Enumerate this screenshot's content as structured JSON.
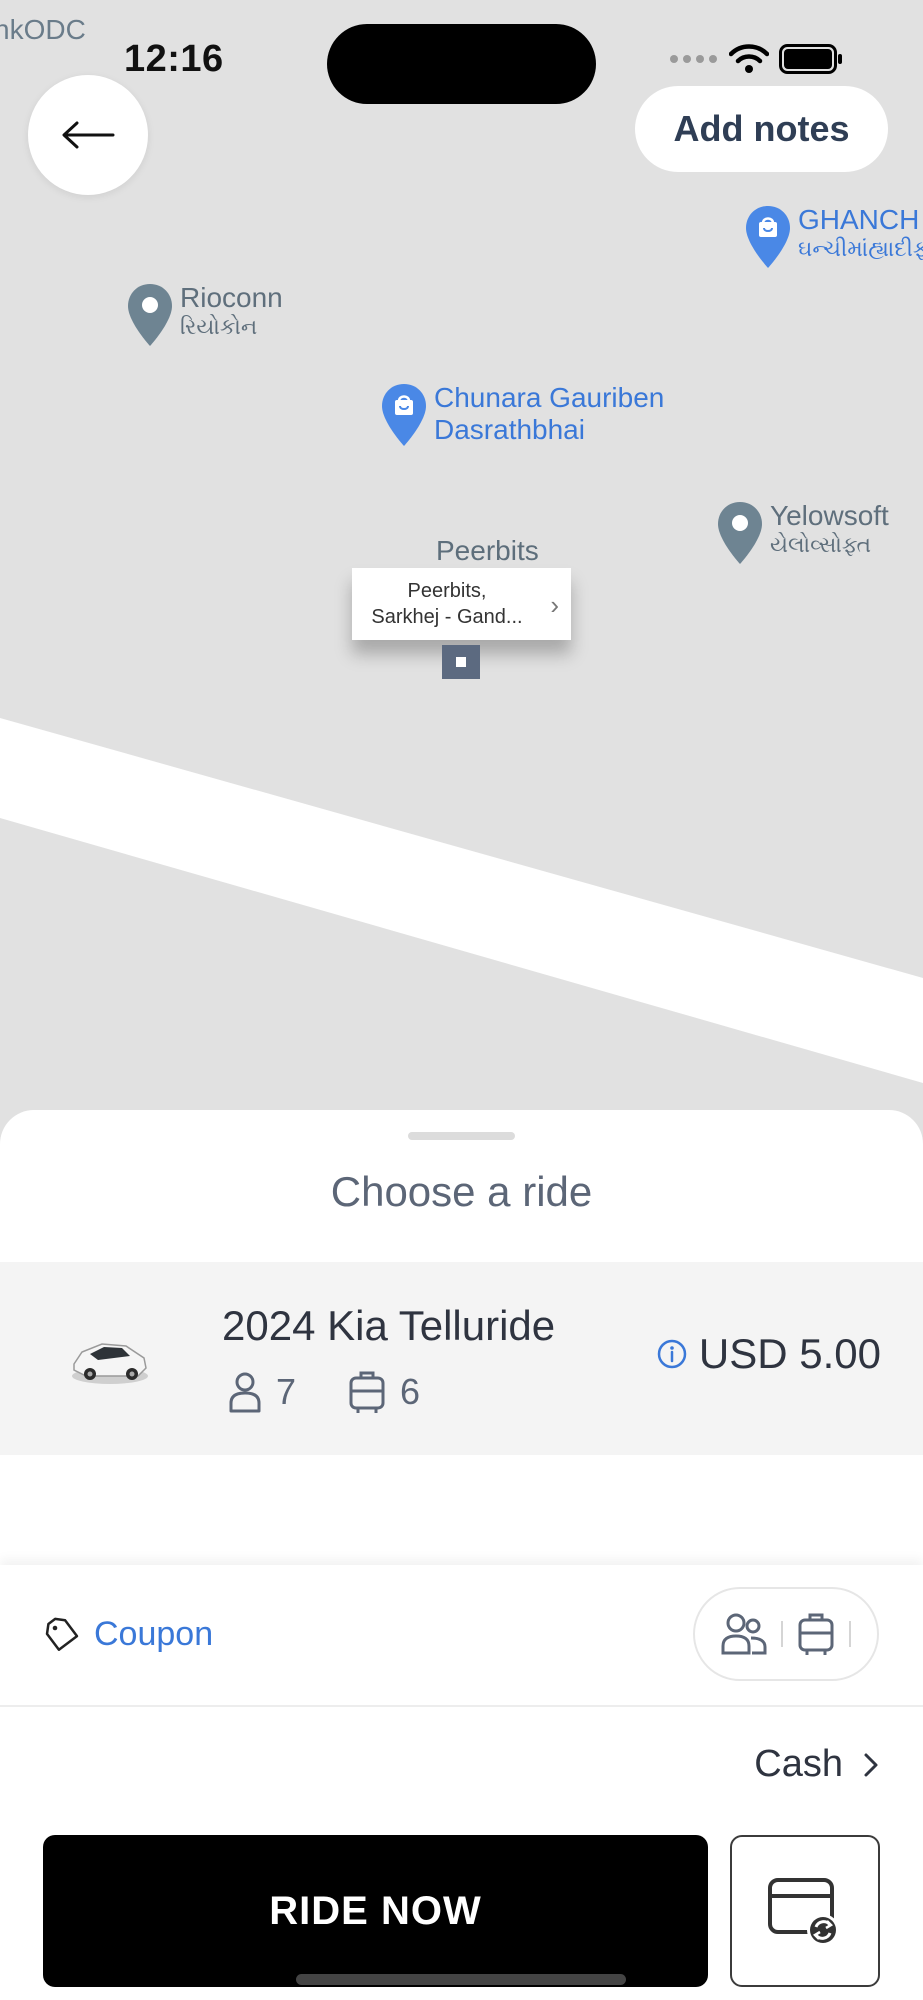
{
  "status_bar": {
    "time": "12:16"
  },
  "map": {
    "corner_label": "nkODC",
    "pois": [
      {
        "name": "Rioconn",
        "sub": "રિયોકોન",
        "style": "grey"
      },
      {
        "name": "Chunara Gauriben",
        "name2": "Dasrathbhai",
        "style": "blue"
      },
      {
        "name": "GHANCH",
        "sub": "ઘન્ચીમાંહ્યાદીફ",
        "style": "blue"
      },
      {
        "name": "Yelowsoft",
        "sub": "યેલોવ્સોફ્ત",
        "style": "grey"
      }
    ],
    "area_label": "Peerbits",
    "callout": {
      "line1": "Peerbits,",
      "line2": "Sarkhej - Gand..."
    }
  },
  "top_controls": {
    "add_notes_label": "Add notes"
  },
  "sheet": {
    "title": "Choose a ride",
    "ride": {
      "name": "2024 Kia Telluride",
      "passengers": "7",
      "luggage": "6",
      "price": "USD 5.00"
    },
    "coupon_label": "Coupon",
    "payment_label": "Cash",
    "ride_now_label": "RIDE NOW"
  },
  "icons": {
    "back": "arrow-left-icon",
    "info": "info-icon",
    "passenger": "person-icon",
    "luggage": "luggage-icon",
    "coupon": "tag-icon",
    "schedule": "calendar-refresh-icon"
  },
  "colors": {
    "accent": "#3a78d8",
    "primary_button": "#000000",
    "map_bg": "#e1e1e1"
  }
}
